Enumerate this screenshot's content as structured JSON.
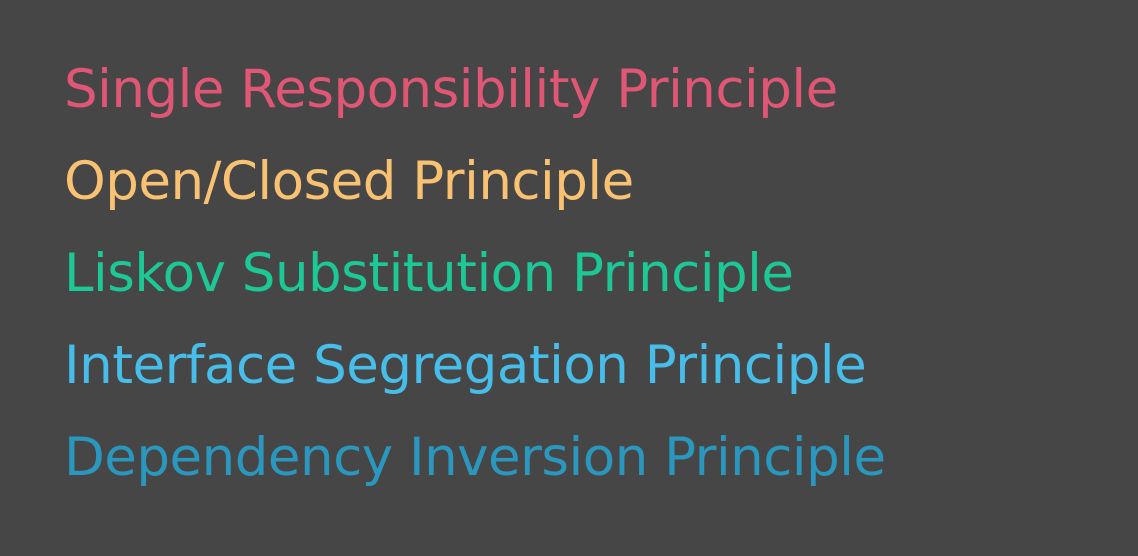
{
  "principles": [
    {
      "label": "Single Responsibility Principle",
      "color": "#E05675"
    },
    {
      "label": "Open/Closed Principle",
      "color": "#F8C272"
    },
    {
      "label": "Liskov Substitution Principle",
      "color": "#1CC996"
    },
    {
      "label": "Interface Segregation Principle",
      "color": "#47BDEA"
    },
    {
      "label": "Dependency Inversion Principle",
      "color": "#2A97BE"
    }
  ],
  "background": "#464646"
}
